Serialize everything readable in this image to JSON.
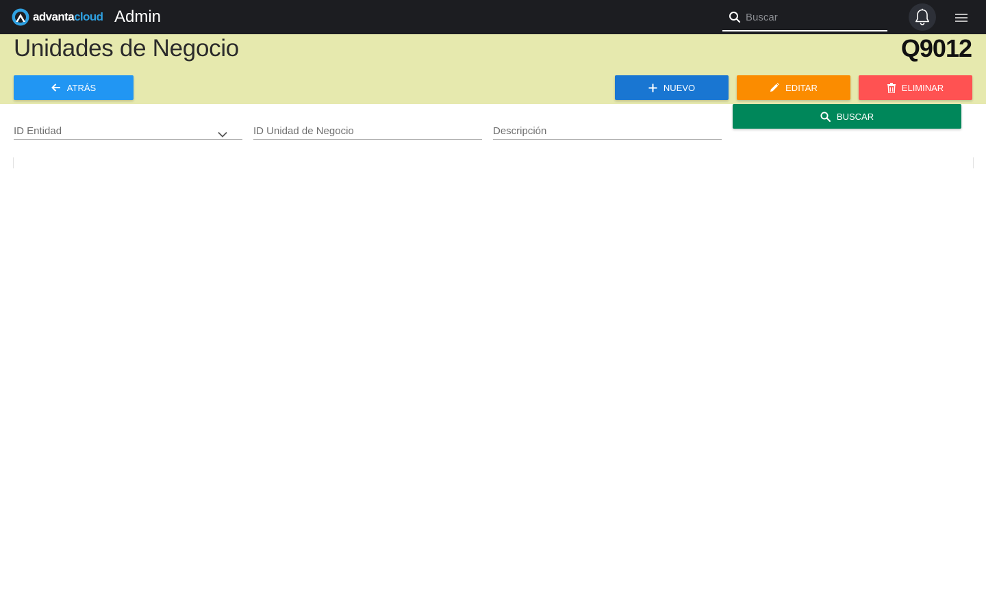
{
  "topbar": {
    "logo_part1": "advanta",
    "logo_part2": "cloud",
    "app_title": "Admin",
    "search_placeholder": "Buscar",
    "icons": [
      "search-icon",
      "bell-icon",
      "hamburger-menu-icon"
    ]
  },
  "header": {
    "page_title": "Unidades de Negocio",
    "page_code": "Q9012",
    "band_color": "#e6e9ae"
  },
  "actions": {
    "back_label": "ATRÁS",
    "new_label": "NUEVO",
    "edit_label": "EDITAR",
    "delete_label": "ELIMINAR",
    "search_label": "BUSCAR",
    "colors": {
      "back": "#2196f3",
      "new": "#1976d2",
      "edit": "#fb8c00",
      "delete": "#ff5252",
      "search": "#00875a"
    }
  },
  "filters": {
    "entity_placeholder": "ID Entidad",
    "unit_placeholder": "ID Unidad de Negocio",
    "description_placeholder": "Descripción"
  }
}
